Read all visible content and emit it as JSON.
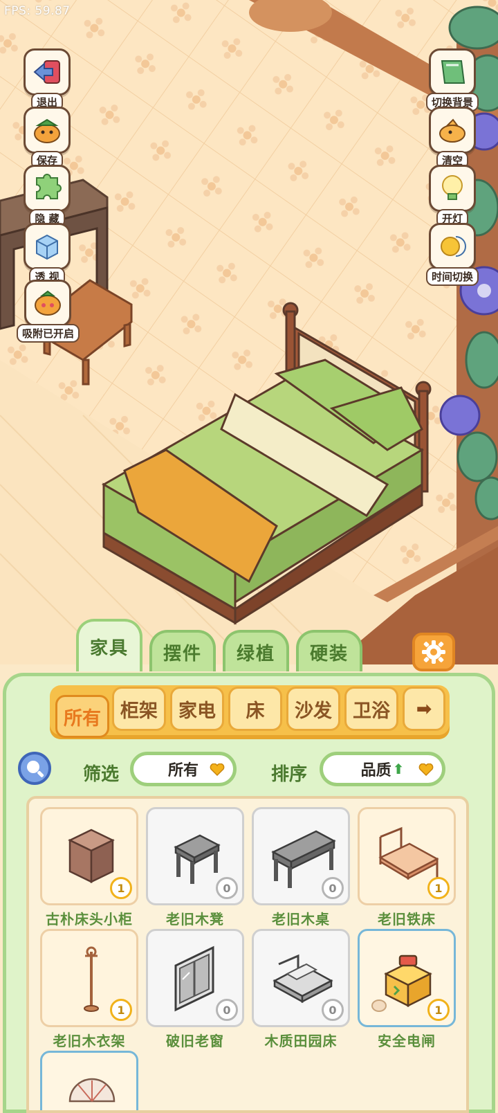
{
  "fps": "FPS: 59.87",
  "left_tools": [
    {
      "label": "退出",
      "icon": "exit-arrow-icon"
    },
    {
      "label": "保存",
      "icon": "save-bird-icon"
    },
    {
      "label": "隐 藏",
      "icon": "hide-puzzle-icon"
    },
    {
      "label": "透 视",
      "icon": "perspective-box-icon"
    },
    {
      "label": "吸附已开启",
      "icon": "snap-magnet-icon"
    }
  ],
  "right_tools": [
    {
      "label": "切换背景",
      "icon": "background-switch-icon"
    },
    {
      "label": "清空",
      "icon": "clear-bird-icon"
    },
    {
      "label": "开灯",
      "icon": "light-bulb-icon"
    },
    {
      "label": "时间切换",
      "icon": "time-switch-icon"
    }
  ],
  "tabs": [
    {
      "label": "家具",
      "active": true
    },
    {
      "label": "摆件",
      "active": false
    },
    {
      "label": "绿植",
      "active": false
    },
    {
      "label": "硬装",
      "active": false
    }
  ],
  "categories": [
    {
      "label": "所有",
      "active": true
    },
    {
      "label": "柜架",
      "active": false
    },
    {
      "label": "家电",
      "active": false
    },
    {
      "label": "床",
      "active": false
    },
    {
      "label": "沙发",
      "active": false
    },
    {
      "label": "卫浴",
      "active": false
    },
    {
      "label": "➡",
      "active": false
    }
  ],
  "filter": {
    "label": "筛选",
    "value": "所有"
  },
  "sort": {
    "label": "排序",
    "value": "品质",
    "arrow": "⬆"
  },
  "items": [
    {
      "name": "古朴床头小柜",
      "count": "1",
      "style": "cream"
    },
    {
      "name": "老旧木凳",
      "count": "0",
      "style": "white"
    },
    {
      "name": "老旧木桌",
      "count": "0",
      "style": "white"
    },
    {
      "name": "老旧铁床",
      "count": "1",
      "style": "cream"
    },
    {
      "name": "老旧木衣架",
      "count": "1",
      "style": "cream"
    },
    {
      "name": "破旧老窗",
      "count": "0",
      "style": "white"
    },
    {
      "name": "木质田园床",
      "count": "0",
      "style": "white"
    },
    {
      "name": "安全电闸",
      "count": "1",
      "style": "blue"
    },
    {
      "name": "",
      "count": "",
      "style": "blue"
    }
  ],
  "colors": {
    "accent_green": "#a6d58a",
    "tab_orange": "#f6c04a",
    "badge_gold": "#f1b21b"
  }
}
